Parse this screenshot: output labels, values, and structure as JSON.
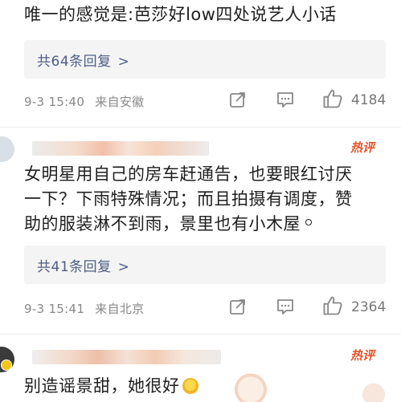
{
  "comments": [
    {
      "text": "唯一的感觉是:芭莎好low四处说艺人小话",
      "replies_label": "共64条回复",
      "date": "9-3 15:40",
      "location": "来自安徽",
      "likes": "4184"
    },
    {
      "hot_label": "热评",
      "text_line1": "女明星用自己的房车赶通告，也要眼红讨厌",
      "text_line2": "一下？下雨特殊情况；而且拍摄有调度，赞",
      "text_line3": "助的服装淋不到雨，景里也有小木屋",
      "replies_label": "共41条回复",
      "date": "9-3 15:41",
      "location": "来自北京",
      "likes": "2364"
    },
    {
      "hot_label": "热评",
      "text": "别造谣景甜，她很好"
    }
  ],
  "icons": {
    "share": "share-icon",
    "comment": "comment-icon",
    "like": "thumbs-up-icon",
    "chevron": "chevron-right-icon"
  },
  "colors": {
    "link": "#4d5f85",
    "hot": "#e5532a",
    "meta": "#888888"
  }
}
